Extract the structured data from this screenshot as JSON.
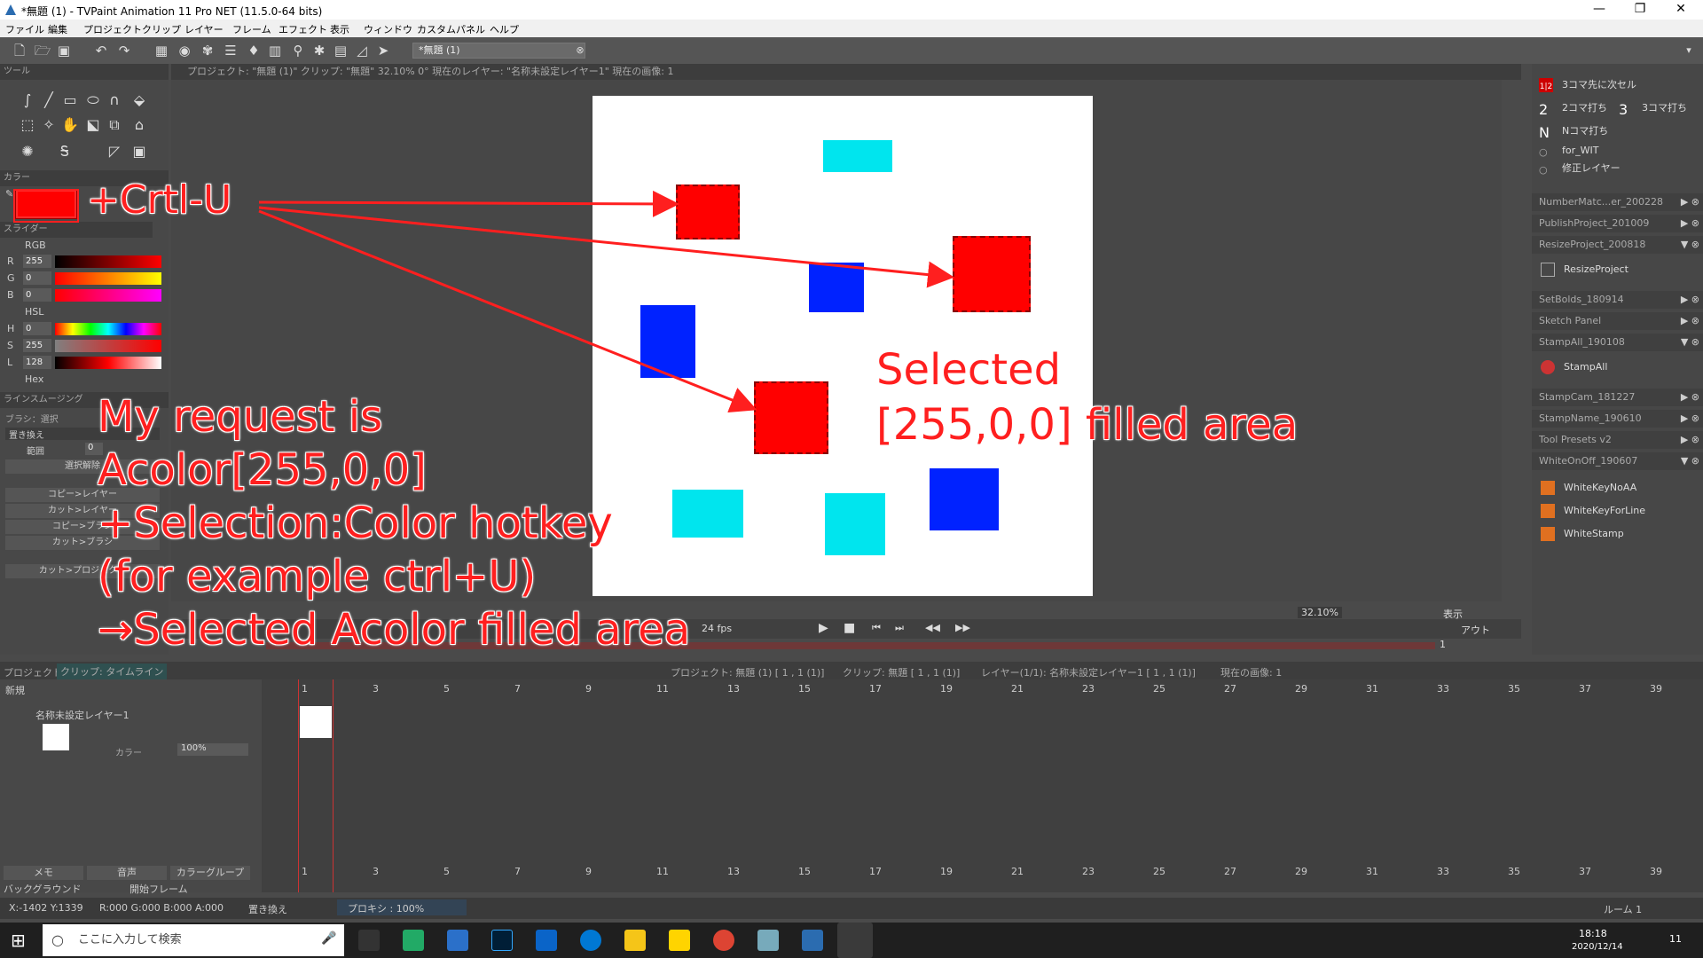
{
  "window": {
    "title": "*無題 (1) - TVPaint Animation 11 Pro NET (11.5.0-64 bits)",
    "minimize": "—",
    "restore": "❐",
    "close": "✕"
  },
  "menu": [
    "ファイル",
    "編集",
    "プロジェクト",
    "クリップ",
    "レイヤー",
    "フレーム",
    "エフェクト",
    "表示",
    "ウィンドウ",
    "カスタムパネル",
    "ヘルプ"
  ],
  "toolbar": {
    "project_tab": "*無題 (1)"
  },
  "tools_panel": {
    "title": "ツール"
  },
  "color_panel": {
    "title": "カラー",
    "color": "#ff0000"
  },
  "sliders_panel": {
    "title": "スライダー",
    "rgb_label": "RGB",
    "rows": [
      {
        "label": "R",
        "value": "255"
      },
      {
        "label": "G",
        "value": "0"
      },
      {
        "label": "B",
        "value": "0"
      }
    ],
    "hsl_label": "HSL",
    "hsl_rows": [
      {
        "label": "H",
        "value": "0"
      },
      {
        "label": "S",
        "value": "255"
      },
      {
        "label": "L",
        "value": "128"
      }
    ],
    "hex_label": "Hex"
  },
  "lines_panel": {
    "title": "ラインスムージング",
    "brush": "ブラシ：選択",
    "replace": "置き換え",
    "range_label": "範囲",
    "range_value": "0",
    "buttons": [
      "選択解除",
      "コピー>レイヤー",
      "カット>レイヤー",
      "コピー>ブラシ",
      "カット>ブラシ",
      "カット>プロジェクト"
    ]
  },
  "viewer": {
    "info": "プロジェクト: \"無題 (1)\" クリップ: \"無題\" 32.10%  0°  現在のレイヤー: \"名称未設定レイヤー1\" 現在の画像: 1",
    "fps": "24 fps",
    "zoom": "32.10%",
    "display": "表示",
    "out": "アウト",
    "frame": "1"
  },
  "right_panel": {
    "top_items": [
      {
        "icon": "1|2",
        "label": "3コマ先に次セル"
      },
      {
        "icon": "2",
        "label": "2コマ打ち"
      },
      {
        "icon": "3",
        "label": "3コマ打ち"
      },
      {
        "icon": "N",
        "label": "Nコマ打ち"
      },
      {
        "icon": "○",
        "label": "for_WIT"
      },
      {
        "icon": "○",
        "label": "修正レイヤー"
      }
    ],
    "items": [
      {
        "label": "NumberMatc...er_200228"
      },
      {
        "label": "PublishProject_201009"
      },
      {
        "label": "ResizeProject_200818",
        "sub": "ResizeProject"
      },
      {
        "label": "SetBolds_180914"
      },
      {
        "label": "Sketch Panel"
      },
      {
        "label": "StampAll_190108",
        "sub": "StampAll"
      },
      {
        "label": "StampCam_181227"
      },
      {
        "label": "StampName_190610"
      },
      {
        "label": "Tool Presets v2"
      },
      {
        "label": "WhiteOnOff_190607",
        "subs": [
          "WhiteKeyNoAA",
          "WhiteKeyForLine",
          "WhiteStamp"
        ]
      }
    ]
  },
  "timeline": {
    "tabs": [
      "プロジェクト",
      "クリップ: タイムライン"
    ],
    "info": [
      "プロジェクト: 無題 (1) [ 1 , 1  (1)]",
      "クリップ: 無題 [ 1 , 1  (1)]",
      "レイヤー(1/1): 名称未設定レイヤー1 [ 1 , 1  (1)]",
      "現在の画像: 1"
    ],
    "new_label": "新規",
    "layer_name": "名称未設定レイヤー1",
    "layer_color_label": "カラー",
    "opacity": "100%",
    "frame_numbers": [
      "1",
      "3",
      "5",
      "7",
      "9",
      "11",
      "13",
      "15",
      "17",
      "19",
      "21",
      "23",
      "25",
      "27",
      "29",
      "31",
      "33",
      "35",
      "37",
      "39"
    ],
    "bottom_tabs": [
      "メモ",
      "音声",
      "カラーグループ"
    ],
    "background": "バックグラウンド",
    "start_frame": "開始フレーム"
  },
  "status": {
    "coords": "X:-1402  Y:1339",
    "rgba": "R:000 G:000 B:000 A:000",
    "mode": "置き換え",
    "proxy": "プロキシ : 100%",
    "room": "ルーム 1"
  },
  "taskbar": {
    "search": "ここに入力して検索",
    "time": "18:18",
    "date": "2020/12/14",
    "notif": "11"
  },
  "annotations": {
    "hotkey": "+Crtl-U",
    "request_lines": [
      "My request is",
      "Acolor[255,0,0]",
      "+Selection:Color hotkey",
      "(for example ctrl+U)",
      "→Selected Acolor filled area"
    ],
    "selected_lines": [
      "Selected",
      "[255,0,0] filled area"
    ]
  }
}
